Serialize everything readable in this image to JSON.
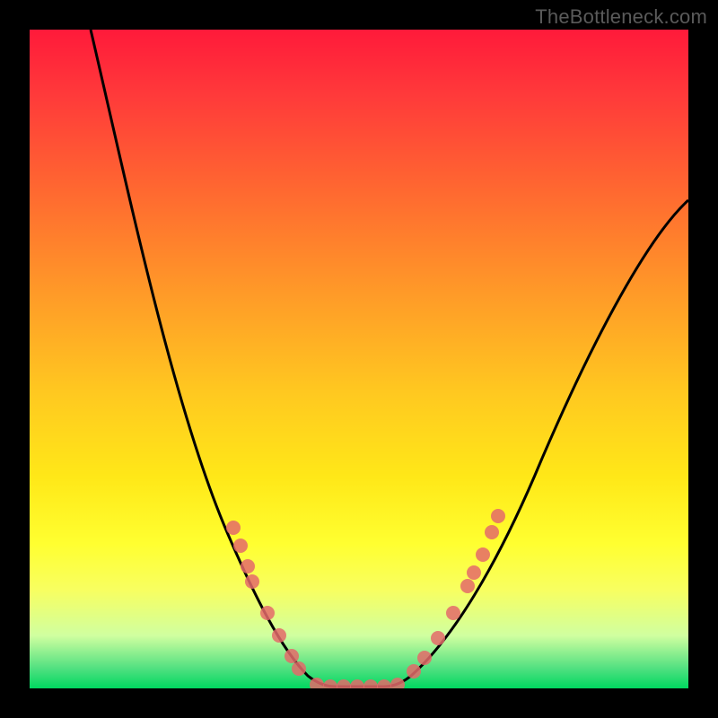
{
  "chart_data": {
    "type": "line",
    "title": "",
    "watermark": "TheBottleneck.com",
    "xlabel": "",
    "ylabel": "",
    "xlim": [
      0,
      100
    ],
    "ylim": [
      0,
      100
    ],
    "grid": false,
    "legend": false,
    "background_gradient": {
      "orientation": "vertical",
      "stops": [
        {
          "pos": 0.0,
          "color": "#ff1a3a"
        },
        {
          "pos": 0.25,
          "color": "#ff6a30"
        },
        {
          "pos": 0.55,
          "color": "#ffc820"
        },
        {
          "pos": 0.78,
          "color": "#ffff30"
        },
        {
          "pos": 0.92,
          "color": "#d0ffa0"
        },
        {
          "pos": 1.0,
          "color": "#00d860"
        }
      ]
    },
    "series": [
      {
        "name": "bottleneck-curve",
        "color": "#000000",
        "x": [
          9,
          15,
          22,
          30,
          37,
          42,
          46,
          50,
          54,
          58,
          64,
          71,
          78,
          86,
          94,
          100
        ],
        "y": [
          100,
          75,
          50,
          30,
          15,
          6,
          1,
          0,
          1,
          6,
          18,
          35,
          52,
          66,
          72,
          74
        ]
      }
    ],
    "markers": {
      "color": "#e46a6a",
      "radius_px": 8,
      "points": [
        {
          "x": 31,
          "y": 24
        },
        {
          "x": 32,
          "y": 22
        },
        {
          "x": 33,
          "y": 19
        },
        {
          "x": 34,
          "y": 16
        },
        {
          "x": 36,
          "y": 11
        },
        {
          "x": 38,
          "y": 8
        },
        {
          "x": 40,
          "y": 5
        },
        {
          "x": 41,
          "y": 3
        },
        {
          "x": 44,
          "y": 1
        },
        {
          "x": 46,
          "y": 0
        },
        {
          "x": 48,
          "y": 0
        },
        {
          "x": 50,
          "y": 0
        },
        {
          "x": 52,
          "y": 0
        },
        {
          "x": 54,
          "y": 0
        },
        {
          "x": 56,
          "y": 1
        },
        {
          "x": 58,
          "y": 3
        },
        {
          "x": 60,
          "y": 5
        },
        {
          "x": 62,
          "y": 8
        },
        {
          "x": 64,
          "y": 11
        },
        {
          "x": 66,
          "y": 15
        },
        {
          "x": 67,
          "y": 18
        },
        {
          "x": 69,
          "y": 20
        },
        {
          "x": 70,
          "y": 24
        },
        {
          "x": 71,
          "y": 26
        }
      ]
    },
    "annotations": []
  }
}
